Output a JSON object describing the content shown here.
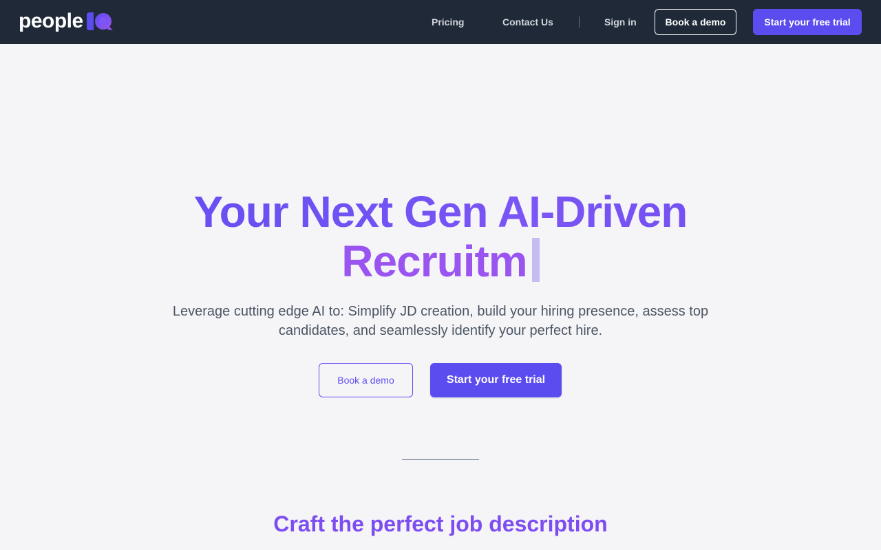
{
  "nav": {
    "logo_text": "people",
    "logo_icon": "iq-speech-bubble-icon",
    "links": [
      {
        "label": "Pricing"
      },
      {
        "label": "Contact Us"
      }
    ],
    "sign_in": "Sign in",
    "book_demo": "Book a demo",
    "free_trial": "Start your free trial"
  },
  "hero": {
    "title_line1": "Your Next Gen AI-Driven",
    "title_line2": "Recruitm",
    "subtitle": "Leverage cutting edge AI to: Simplify JD creation, build your hiring presence, assess top candidates, and seamlessly identify your perfect hire.",
    "book_demo": "Book a demo",
    "free_trial": "Start your free trial"
  },
  "section": {
    "title": "Craft the perfect job description"
  },
  "colors": {
    "nav_bg": "#1f2937",
    "accent": "#5b4cf0",
    "gradient_purple": "#9a55f0",
    "page_bg": "#f5f5f8"
  }
}
